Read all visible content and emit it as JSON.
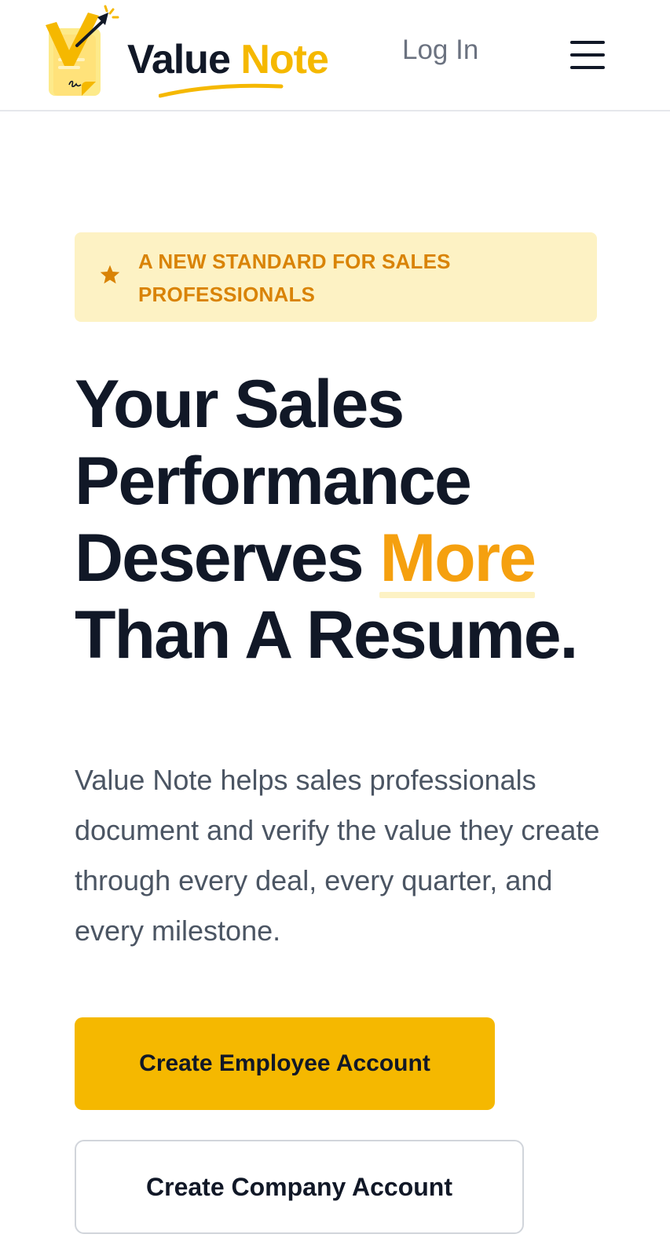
{
  "header": {
    "logo": {
      "word_primary": "Value",
      "word_accent": "Note",
      "icon": "value-note-logo-icon"
    },
    "login_label": "Log In",
    "menu_icon": "hamburger-menu-icon"
  },
  "hero": {
    "badge": {
      "icon": "star-icon",
      "text": "A NEW STANDARD FOR SALES PROFESSIONALS"
    },
    "headline": {
      "before": "Your Sales Performance Deserves",
      "highlight": "More",
      "after": "Than A Resume."
    },
    "description": "Value Note helps sales professionals document and verify the value they create through every deal, every quarter, and every milestone.",
    "primary_button_label": "Create Employee Account",
    "secondary_button_label": "Create Company Account"
  },
  "colors": {
    "brand_yellow": "#f5b800",
    "highlight_orange": "#f5a00f",
    "badge_bg": "#fdf2c4",
    "badge_text": "#d98306",
    "heading": "#111827",
    "body_text": "#4b5563",
    "muted": "#6b7280"
  }
}
